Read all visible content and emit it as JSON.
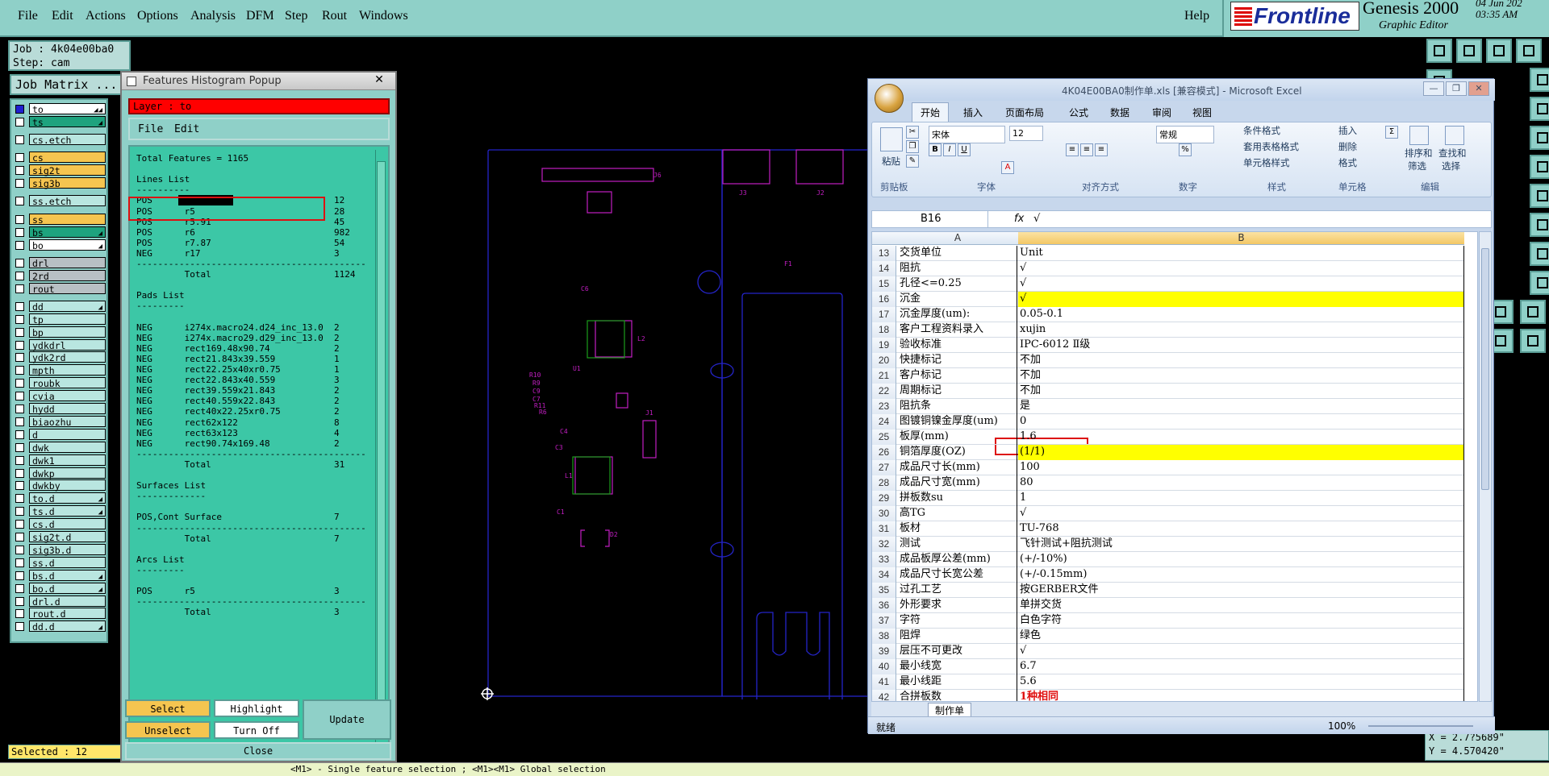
{
  "genesis": {
    "menu": [
      "File",
      "Edit",
      "Actions",
      "Options",
      "Analysis",
      "DFM",
      "Step",
      "Rout",
      "Windows"
    ],
    "help": "Help",
    "brand": "Frontline",
    "product": "Genesis 2000",
    "subtitle": "Graphic Editor",
    "date_line1": "04 Jun 202",
    "date_line2": "03:35 AM",
    "job_label": "Job : 4k04e00ba0",
    "step_label": "Step: cam",
    "job_matrix": "Job Matrix ...",
    "selected": "Selected : 12",
    "coord_x": "X = 2.7?5689\"",
    "coord_y": "Y = 4.570420\"",
    "hint": "<M1> - Single feature selection ; <M1><M1> Global selection",
    "layers": [
      {
        "name": "to",
        "bg": "#ffffff",
        "row": 0,
        "arrow": "◢◢"
      },
      {
        "name": "ts",
        "bg": "#1ea37e",
        "row": 1,
        "arrow": "◢"
      },
      {
        "name": "cs.etch",
        "bg": "#b9e6e0",
        "row": 2.4
      },
      {
        "name": "cs",
        "bg": "#f5c550",
        "row": 3.8
      },
      {
        "name": "sig2t",
        "bg": "#f5c550",
        "row": 4.8
      },
      {
        "name": "sig3b",
        "bg": "#f5c550",
        "row": 5.8
      },
      {
        "name": "ss.etch",
        "bg": "#b9e6e0",
        "row": 7.2
      },
      {
        "name": "ss",
        "bg": "#f5c550",
        "row": 8.6
      },
      {
        "name": "bs",
        "bg": "#1ea37e",
        "row": 9.6,
        "arrow": "◢"
      },
      {
        "name": "bo",
        "bg": "#ffffff",
        "row": 10.6,
        "arrow": "◢"
      },
      {
        "name": "drl",
        "bg": "#b8c0c4",
        "row": 12
      },
      {
        "name": "2rd",
        "bg": "#b8c0c4",
        "row": 13
      },
      {
        "name": "rout",
        "bg": "#b8c0c4",
        "row": 14
      },
      {
        "name": "dd",
        "bg": "#b9e6e0",
        "row": 15.4,
        "arrow": "◢"
      },
      {
        "name": "tp",
        "bg": "#b9e6e0",
        "row": 16.4
      },
      {
        "name": "bp",
        "bg": "#b9e6e0",
        "row": 17.4
      },
      {
        "name": "ydkdrl",
        "bg": "#b9e6e0",
        "row": 18.4
      },
      {
        "name": "ydk2rd",
        "bg": "#b9e6e0",
        "row": 19.4
      },
      {
        "name": "mpth",
        "bg": "#b9e6e0",
        "row": 20.4
      },
      {
        "name": "roubk",
        "bg": "#b9e6e0",
        "row": 21.4
      },
      {
        "name": "cvia",
        "bg": "#b9e6e0",
        "row": 22.4
      },
      {
        "name": "hydd",
        "bg": "#b9e6e0",
        "row": 23.4
      },
      {
        "name": "biaozhu",
        "bg": "#b9e6e0",
        "row": 24.4
      },
      {
        "name": "d",
        "bg": "#b9e6e0",
        "row": 25.4
      },
      {
        "name": "dwk",
        "bg": "#b9e6e0",
        "row": 26.4
      },
      {
        "name": "dwk1",
        "bg": "#b9e6e0",
        "row": 27.4
      },
      {
        "name": "dwkp",
        "bg": "#b9e6e0",
        "row": 28.4
      },
      {
        "name": "dwkby",
        "bg": "#b9e6e0",
        "row": 29.4
      },
      {
        "name": "to.d",
        "bg": "#b9e6e0",
        "row": 30.4,
        "arrow": "◢"
      },
      {
        "name": "ts.d",
        "bg": "#b9e6e0",
        "row": 31.4,
        "arrow": "◢"
      },
      {
        "name": "cs.d",
        "bg": "#b9e6e0",
        "row": 32.4
      },
      {
        "name": "sig2t.d",
        "bg": "#b9e6e0",
        "row": 33.4
      },
      {
        "name": "sig3b.d",
        "bg": "#b9e6e0",
        "row": 34.4
      },
      {
        "name": "ss.d",
        "bg": "#b9e6e0",
        "row": 35.4
      },
      {
        "name": "bs.d",
        "bg": "#b9e6e0",
        "row": 36.4,
        "arrow": "◢"
      },
      {
        "name": "bo.d",
        "bg": "#b9e6e0",
        "row": 37.4,
        "arrow": "◢"
      },
      {
        "name": "drl.d",
        "bg": "#b9e6e0",
        "row": 38.4
      },
      {
        "name": "rout.d",
        "bg": "#b9e6e0",
        "row": 39.4
      },
      {
        "name": "dd.d",
        "bg": "#b9e6e0",
        "row": 40.4,
        "arrow": "◢"
      }
    ]
  },
  "histogram": {
    "title": "Features Histogram Popup",
    "layer": "Layer :  to",
    "menu_file": "File",
    "menu_edit": "Edit",
    "rows": [
      "Total Features = 1165",
      "",
      "Lines List",
      "----------",
      "POS      r4                          12",
      "POS      r5                          28",
      "POS      r5.91                       45",
      "POS      r6                          982",
      "POS      r7.87                       54",
      "NEG      r17                         3",
      "-------------------------------------------",
      "         Total                       1124",
      "",
      "Pads List",
      "---------",
      "",
      "NEG      i274x.macro24.d24_inc_13.0  2",
      "NEG      i274x.macro29.d29_inc_13.0  2",
      "NEG      rect169.48x90.74            2",
      "NEG      rect21.843x39.559           1",
      "NEG      rect22.25x40xr0.75          1",
      "NEG      rect22.843x40.559           3",
      "NEG      rect39.559x21.843           2",
      "NEG      rect40.559x22.843           2",
      "NEG      rect40x22.25xr0.75          2",
      "NEG      rect62x122                  8",
      "NEG      rect63x123                  4",
      "NEG      rect90.74x169.48            2",
      "-------------------------------------------",
      "         Total                       31",
      "",
      "Surfaces List",
      "-------------",
      "",
      "POS,Cont Surface                     7",
      "-------------------------------------------",
      "         Total                       7",
      "",
      "Arcs List",
      "---------",
      "",
      "POS      r5                          3",
      "-------------------------------------------",
      "         Total                       3"
    ],
    "btn_select": "Select",
    "btn_highlight": "Highlight",
    "btn_update": "Update",
    "btn_unselect": "Unselect",
    "btn_turnoff": "Turn Off",
    "btn_close": "Close"
  },
  "canvas_labels": [
    "J6",
    "J3",
    "J2",
    "F1",
    "C6",
    "L2",
    "U1",
    "R10",
    "R9",
    "C9",
    "C7",
    "R11",
    "R6",
    "C4",
    "C3",
    "C1",
    "D2",
    "L1",
    "J1",
    "C5",
    "R?"
  ],
  "excel": {
    "title": "4K04E00BA0制作单.xls  [兼容模式] - Microsoft Excel",
    "tabs": [
      "开始",
      "插入",
      "页面布局",
      "公式",
      "数据",
      "审阅",
      "视图"
    ],
    "font_name": "宋体",
    "font_size": "12",
    "number_format": "常规",
    "groups": [
      "剪贴板",
      "字体",
      "对齐方式",
      "数字",
      "样式",
      "单元格",
      "编辑"
    ],
    "paste": "粘贴",
    "styles": [
      "条件格式",
      "套用表格格式",
      "单元格样式"
    ],
    "cells_cmds": [
      "插入",
      "删除",
      "格式"
    ],
    "edit_cmds": [
      "排序和",
      "筛选",
      "查找和",
      "选择"
    ],
    "name_box": "B16",
    "formula": "√",
    "col_a": "A",
    "col_b": "B",
    "rows": [
      {
        "n": "13",
        "a": "交货单位",
        "b": "Unit"
      },
      {
        "n": "14",
        "a": "阻抗",
        "b": "√"
      },
      {
        "n": "15",
        "a": "孔径<=0.25",
        "b": "√"
      },
      {
        "n": "16",
        "a": "沉金",
        "b": "√",
        "hl": true
      },
      {
        "n": "17",
        "a": "沉金厚度(um):",
        "b": "0.05-0.1"
      },
      {
        "n": "18",
        "a": "客户工程资料录入",
        "b": "xujin"
      },
      {
        "n": "19",
        "a": "验收标准",
        "b": "IPC-6012 Ⅱ级"
      },
      {
        "n": "20",
        "a": "快捷标记",
        "b": "不加"
      },
      {
        "n": "21",
        "a": "客户标记",
        "b": "不加"
      },
      {
        "n": "22",
        "a": "周期标记",
        "b": "不加"
      },
      {
        "n": "23",
        "a": "阻抗条",
        "b": "是"
      },
      {
        "n": "24",
        "a": "图镀铜镍金厚度(um)",
        "b": "0"
      },
      {
        "n": "25",
        "a": "板厚(mm)",
        "b": "1.6"
      },
      {
        "n": "26",
        "a": "铜箔厚度(OZ)",
        "b": "(1/1)",
        "hl": true
      },
      {
        "n": "27",
        "a": "成品尺寸长(mm)",
        "b": "100"
      },
      {
        "n": "28",
        "a": "成品尺寸宽(mm)",
        "b": "80"
      },
      {
        "n": "29",
        "a": "拼板数su",
        "b": "1"
      },
      {
        "n": "30",
        "a": "高TG",
        "b": "√"
      },
      {
        "n": "31",
        "a": "板材",
        "b": "TU-768"
      },
      {
        "n": "32",
        "a": "测试",
        "b": "飞针测试+阻抗测试"
      },
      {
        "n": "33",
        "a": "成品板厚公差(mm)",
        "b": "(+/-10%)"
      },
      {
        "n": "34",
        "a": "成品尺寸长宽公差",
        "b": "(+/-0.15mm)"
      },
      {
        "n": "35",
        "a": "过孔工艺",
        "b": "按GERBER文件"
      },
      {
        "n": "36",
        "a": "外形要求",
        "b": "单拼交货"
      },
      {
        "n": "37",
        "a": "字符",
        "b": "白色字符"
      },
      {
        "n": "38",
        "a": "阻焊",
        "b": "绿色"
      },
      {
        "n": "39",
        "a": "层压不可更改",
        "b": "√"
      },
      {
        "n": "40",
        "a": "最小线宽",
        "b": "6.7"
      },
      {
        "n": "41",
        "a": "最小线距",
        "b": "5.6"
      },
      {
        "n": "42",
        "a": "合拼板数",
        "b": "1种相同",
        "red": true
      }
    ],
    "sheet_tab": "制作单",
    "status": "就绪",
    "zoom": "100%"
  }
}
